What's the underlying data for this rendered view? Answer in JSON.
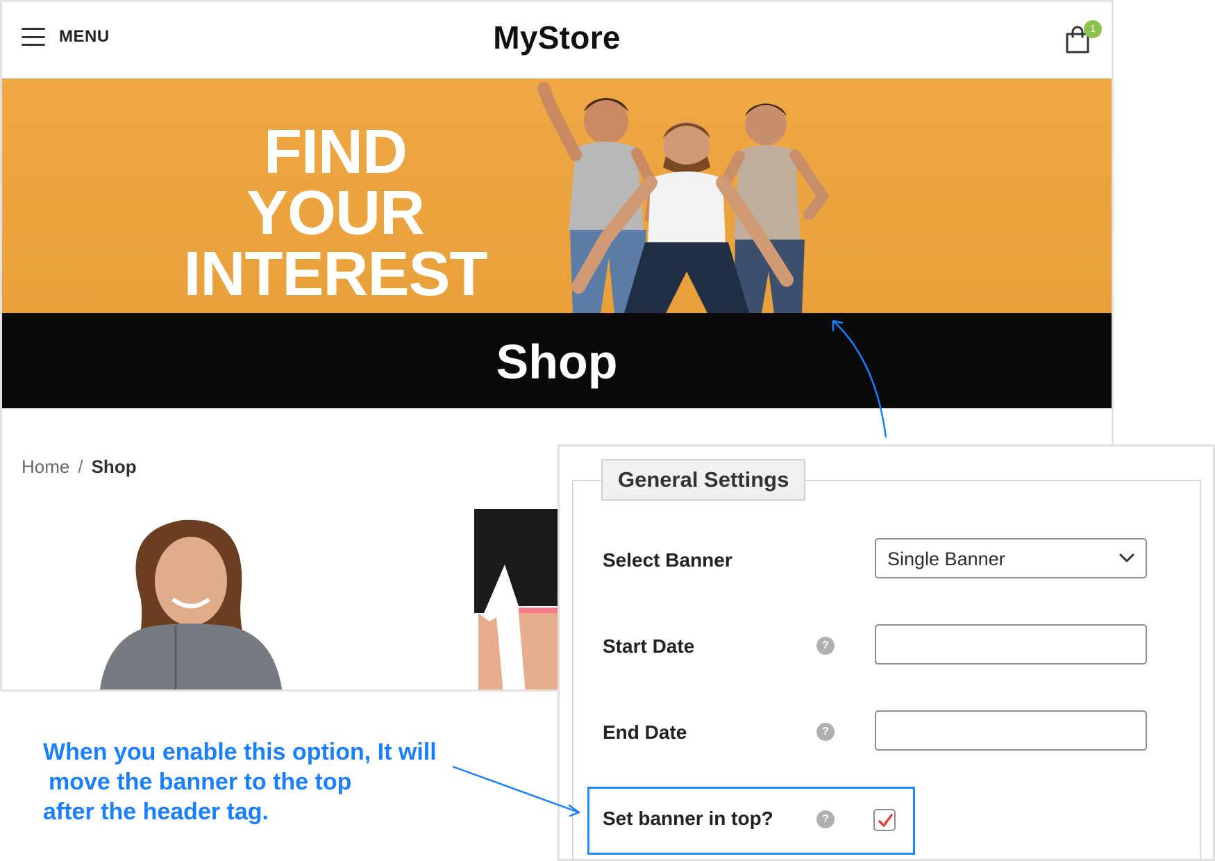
{
  "header": {
    "menu_label": "MENU",
    "brand": "MyStore",
    "cart_count": "1"
  },
  "banner": {
    "line1": "FIND",
    "line2": "YOUR",
    "line3": "INTEREST"
  },
  "page_title": "Shop",
  "breadcrumb": {
    "home": "Home",
    "separator": "/",
    "current": "Shop"
  },
  "settings": {
    "legend": "General Settings",
    "select_banner_label": "Select Banner",
    "select_banner_value": "Single Banner",
    "start_date_label": "Start Date",
    "start_date_value": "",
    "end_date_label": "End Date",
    "end_date_value": "",
    "top_label": "Set banner in top?",
    "top_checked": true,
    "help_glyph": "?"
  },
  "annotation": {
    "line1": "When you enable this option, It will",
    "line2": "move the banner to the top",
    "line3": "after the header tag."
  },
  "colors": {
    "banner_orange": "#eba43f",
    "annotation_blue": "#1a7fff",
    "cart_badge": "#8bc34a",
    "check_mark": "#e2403a"
  }
}
